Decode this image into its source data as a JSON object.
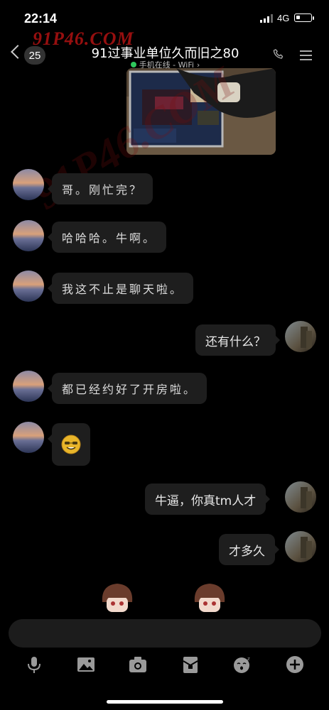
{
  "status_bar": {
    "time": "22:14",
    "network": "4G"
  },
  "header": {
    "unread_count": "25",
    "watermark": "91P46.COM",
    "title": "91过事业单位久而旧之80",
    "subtitle_status": "手机在线 - WiFi",
    "subtitle_chevron": "›"
  },
  "messages": [
    {
      "side": "left",
      "text": "哥。刚忙完？"
    },
    {
      "side": "left",
      "text": "哈哈哈。牛啊。"
    },
    {
      "side": "left",
      "text": "我这不止是聊天啦。"
    },
    {
      "side": "right",
      "text": "还有什么？"
    },
    {
      "side": "left",
      "text": "都已经约好了开房啦。"
    },
    {
      "side": "left",
      "text": ""
    },
    {
      "side": "right",
      "text": "牛逼，你真tm人才"
    },
    {
      "side": "right",
      "text": "才多久"
    }
  ],
  "icons": {
    "back": "chevron-left-icon",
    "phone": "phone-icon",
    "menu": "menu-icon",
    "emoji_message": "grinning-glasses-emoji",
    "toolbar": [
      "microphone-icon",
      "image-icon",
      "camera-icon",
      "red-packet-icon",
      "sticker-icon",
      "plus-icon"
    ]
  },
  "colors": {
    "online": "#2ec95c",
    "bubble": "#1e1e1e",
    "background": "#000000",
    "watermark": "#c81414"
  }
}
